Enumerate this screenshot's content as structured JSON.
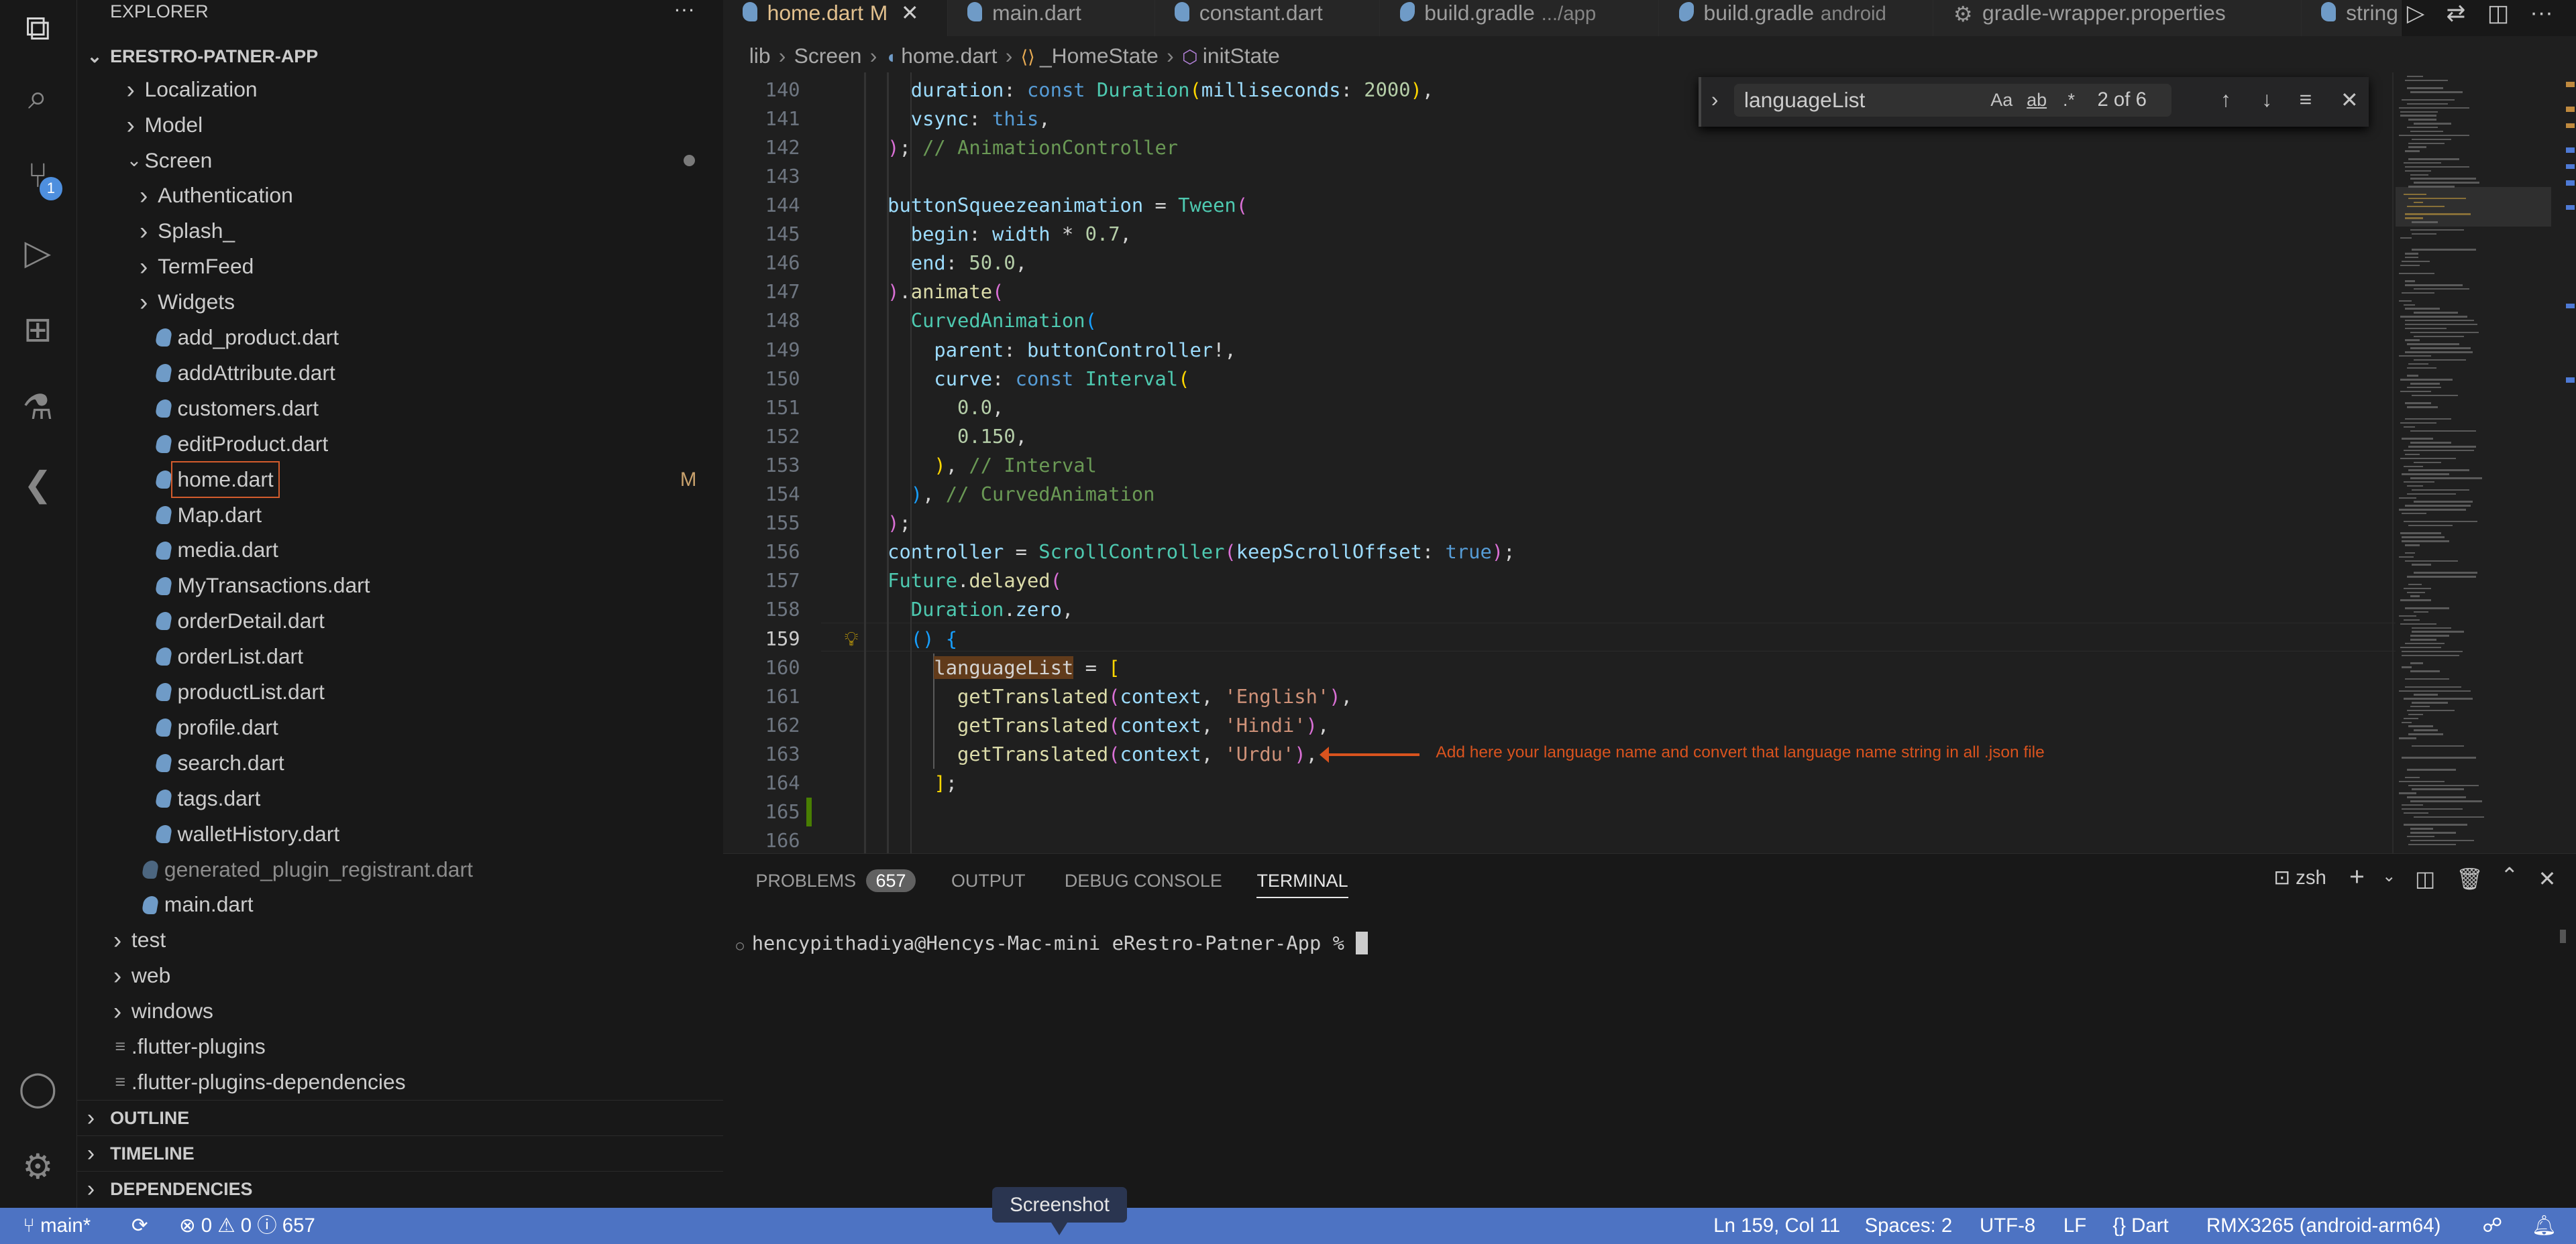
{
  "activity_bar": {
    "items": [
      {
        "name": "explorer-icon",
        "glyph": "⧉"
      },
      {
        "name": "search-icon",
        "glyph": "⌕"
      },
      {
        "name": "source-control-icon",
        "glyph": "⑂",
        "badge": "1"
      },
      {
        "name": "run-debug-icon",
        "glyph": "▷"
      },
      {
        "name": "extensions-icon",
        "glyph": "⊞"
      },
      {
        "name": "testing-icon",
        "glyph": "⚗"
      },
      {
        "name": "flutter-icon",
        "glyph": "❮"
      }
    ],
    "bottom": [
      {
        "name": "account-icon",
        "glyph": "◯"
      },
      {
        "name": "settings-gear-icon",
        "glyph": "⚙"
      }
    ]
  },
  "sidebar": {
    "title": "EXPLORER",
    "more": "···",
    "project": "ERESTRO-PATNER-APP",
    "tree": [
      {
        "label": "Localization",
        "type": "folder",
        "depth": 1
      },
      {
        "label": "Model",
        "type": "folder",
        "depth": 1
      },
      {
        "label": "Screen",
        "type": "folder-open",
        "depth": 1,
        "dot": true
      },
      {
        "label": "Authentication",
        "type": "folder",
        "depth": 2
      },
      {
        "label": "Splash_",
        "type": "folder",
        "depth": 2
      },
      {
        "label": "TermFeed",
        "type": "folder",
        "depth": 2
      },
      {
        "label": "Widgets",
        "type": "folder",
        "depth": 2
      },
      {
        "label": "add_product.dart",
        "type": "dart",
        "depth": 2
      },
      {
        "label": "addAttribute.dart",
        "type": "dart",
        "depth": 2
      },
      {
        "label": "customers.dart",
        "type": "dart",
        "depth": 2
      },
      {
        "label": "editProduct.dart",
        "type": "dart",
        "depth": 2
      },
      {
        "label": "home.dart",
        "type": "dart",
        "depth": 2,
        "selected": true,
        "status": "M"
      },
      {
        "label": "Map.dart",
        "type": "dart",
        "depth": 2
      },
      {
        "label": "media.dart",
        "type": "dart",
        "depth": 2
      },
      {
        "label": "MyTransactions.dart",
        "type": "dart",
        "depth": 2
      },
      {
        "label": "orderDetail.dart",
        "type": "dart",
        "depth": 2
      },
      {
        "label": "orderList.dart",
        "type": "dart",
        "depth": 2
      },
      {
        "label": "productList.dart",
        "type": "dart",
        "depth": 2
      },
      {
        "label": "profile.dart",
        "type": "dart",
        "depth": 2
      },
      {
        "label": "search.dart",
        "type": "dart",
        "depth": 2
      },
      {
        "label": "tags.dart",
        "type": "dart",
        "depth": 2
      },
      {
        "label": "walletHistory.dart",
        "type": "dart",
        "depth": 2
      },
      {
        "label": "generated_plugin_registrant.dart",
        "type": "dart",
        "depth": 1,
        "dim": true
      },
      {
        "label": "main.dart",
        "type": "dart",
        "depth": 1
      },
      {
        "label": "test",
        "type": "folder",
        "depth": 0
      },
      {
        "label": "web",
        "type": "folder",
        "depth": 0
      },
      {
        "label": "windows",
        "type": "folder",
        "depth": 0
      },
      {
        "label": ".flutter-plugins",
        "type": "list",
        "depth": 0
      },
      {
        "label": ".flutter-plugins-dependencies",
        "type": "list",
        "depth": 0
      }
    ],
    "sections": [
      "OUTLINE",
      "TIMELINE",
      "DEPENDENCIES"
    ]
  },
  "tabs": [
    {
      "label": "home.dart",
      "status": "M",
      "active": true,
      "icon": "dart"
    },
    {
      "label": "main.dart",
      "icon": "dart"
    },
    {
      "label": "constant.dart",
      "icon": "dart"
    },
    {
      "label": "build.gradle",
      "desc": ".../app",
      "icon": "gradle"
    },
    {
      "label": "build.gradle",
      "desc": "android",
      "icon": "gradle"
    },
    {
      "label": "gradle-wrapper.properties",
      "icon": "gear"
    },
    {
      "label": "string",
      "icon": "dart"
    }
  ],
  "breadcrumb": [
    "lib",
    "Screen",
    "home.dart",
    "_HomeState",
    "initState"
  ],
  "find": {
    "value": "languageList",
    "options": [
      "Aa",
      "ab",
      ".*"
    ],
    "count": "2 of 6"
  },
  "editor": {
    "current_line": 159,
    "lines": [
      {
        "n": 140,
        "i": 6,
        "t": [
          [
            "var",
            "duration"
          ],
          [
            "p",
            ": "
          ],
          [
            "kw",
            "const "
          ],
          [
            "cls",
            "Duration"
          ],
          [
            "bg",
            "("
          ],
          [
            "var",
            "milliseconds"
          ],
          [
            "p",
            ": "
          ],
          [
            "num",
            "2000"
          ],
          [
            "bg",
            ")"
          ],
          [
            "p",
            ","
          ]
        ]
      },
      {
        "n": 141,
        "i": 6,
        "t": [
          [
            "var",
            "vsync"
          ],
          [
            "p",
            ": "
          ],
          [
            "kw",
            "this"
          ],
          [
            "p",
            ","
          ]
        ]
      },
      {
        "n": 142,
        "i": 4,
        "t": [
          [
            "bp",
            ")"
          ],
          [
            "p",
            "; "
          ],
          [
            "cm",
            "// AnimationController"
          ]
        ]
      },
      {
        "n": 143,
        "i": 0,
        "t": []
      },
      {
        "n": 144,
        "i": 4,
        "t": [
          [
            "var",
            "buttonSqueezeanimation"
          ],
          [
            "p",
            " = "
          ],
          [
            "cls",
            "Tween"
          ],
          [
            "bp",
            "("
          ]
        ]
      },
      {
        "n": 145,
        "i": 6,
        "t": [
          [
            "var",
            "begin"
          ],
          [
            "p",
            ": "
          ],
          [
            "var",
            "width"
          ],
          [
            "p",
            " * "
          ],
          [
            "num",
            "0.7"
          ],
          [
            "p",
            ","
          ]
        ]
      },
      {
        "n": 146,
        "i": 6,
        "t": [
          [
            "var",
            "end"
          ],
          [
            "p",
            ": "
          ],
          [
            "num",
            "50.0"
          ],
          [
            "p",
            ","
          ]
        ]
      },
      {
        "n": 147,
        "i": 4,
        "t": [
          [
            "bp",
            ")"
          ],
          [
            "p",
            "."
          ],
          [
            "fn",
            "animate"
          ],
          [
            "bp",
            "("
          ]
        ]
      },
      {
        "n": 148,
        "i": 6,
        "t": [
          [
            "cls",
            "CurvedAnimation"
          ],
          [
            "bb",
            "("
          ]
        ]
      },
      {
        "n": 149,
        "i": 8,
        "t": [
          [
            "var",
            "parent"
          ],
          [
            "p",
            ": "
          ],
          [
            "var",
            "buttonController"
          ],
          [
            "p",
            "!,"
          ]
        ]
      },
      {
        "n": 150,
        "i": 8,
        "t": [
          [
            "var",
            "curve"
          ],
          [
            "p",
            ": "
          ],
          [
            "kw",
            "const "
          ],
          [
            "cls",
            "Interval"
          ],
          [
            "bg",
            "("
          ]
        ]
      },
      {
        "n": 151,
        "i": 10,
        "t": [
          [
            "num",
            "0.0"
          ],
          [
            "p",
            ","
          ]
        ]
      },
      {
        "n": 152,
        "i": 10,
        "t": [
          [
            "num",
            "0.150"
          ],
          [
            "p",
            ","
          ]
        ]
      },
      {
        "n": 153,
        "i": 8,
        "t": [
          [
            "bg",
            ")"
          ],
          [
            "p",
            ", "
          ],
          [
            "cm",
            "// Interval"
          ]
        ]
      },
      {
        "n": 154,
        "i": 6,
        "t": [
          [
            "bb",
            ")"
          ],
          [
            "p",
            ", "
          ],
          [
            "cm",
            "// CurvedAnimation"
          ]
        ]
      },
      {
        "n": 155,
        "i": 4,
        "t": [
          [
            "bp",
            ")"
          ],
          [
            "p",
            ";"
          ]
        ]
      },
      {
        "n": 156,
        "i": 4,
        "t": [
          [
            "var",
            "controller"
          ],
          [
            "p",
            " = "
          ],
          [
            "cls",
            "ScrollController"
          ],
          [
            "bp",
            "("
          ],
          [
            "var",
            "keepScrollOffset"
          ],
          [
            "p",
            ": "
          ],
          [
            "kw",
            "true"
          ],
          [
            "bp",
            ")"
          ],
          [
            "p",
            ";"
          ]
        ]
      },
      {
        "n": 157,
        "i": 4,
        "t": [
          [
            "cls",
            "Future"
          ],
          [
            "p",
            "."
          ],
          [
            "fn",
            "delayed"
          ],
          [
            "bp",
            "("
          ]
        ]
      },
      {
        "n": 158,
        "i": 6,
        "t": [
          [
            "cls",
            "Duration"
          ],
          [
            "p",
            "."
          ],
          [
            "var",
            "zero"
          ],
          [
            "p",
            ","
          ]
        ]
      },
      {
        "n": 159,
        "i": 6,
        "t": [
          [
            "bb",
            "()"
          ],
          [
            "p",
            " "
          ],
          [
            "bb",
            "{"
          ]
        ]
      },
      {
        "n": 160,
        "i": 8,
        "t": [
          [
            "hl",
            "languageList"
          ],
          [
            "p",
            " = "
          ],
          [
            "bg",
            "["
          ]
        ]
      },
      {
        "n": 161,
        "i": 10,
        "t": [
          [
            "fn",
            "getTranslated"
          ],
          [
            "bp",
            "("
          ],
          [
            "var",
            "context"
          ],
          [
            "p",
            ", "
          ],
          [
            "str",
            "'English'"
          ],
          [
            "bp",
            ")"
          ],
          [
            "p",
            ","
          ]
        ]
      },
      {
        "n": 162,
        "i": 10,
        "t": [
          [
            "fn",
            "getTranslated"
          ],
          [
            "bp",
            "("
          ],
          [
            "var",
            "context"
          ],
          [
            "p",
            ", "
          ],
          [
            "str",
            "'Hindi'"
          ],
          [
            "bp",
            ")"
          ],
          [
            "p",
            ","
          ]
        ]
      },
      {
        "n": 163,
        "i": 10,
        "t": [
          [
            "fn",
            "getTranslated"
          ],
          [
            "bp",
            "("
          ],
          [
            "var",
            "context"
          ],
          [
            "p",
            ", "
          ],
          [
            "str",
            "'Urdu'"
          ],
          [
            "bp",
            ")"
          ],
          [
            "p",
            ","
          ]
        ]
      },
      {
        "n": 164,
        "i": 8,
        "t": [
          [
            "bg",
            "]"
          ],
          [
            "p",
            ";"
          ]
        ]
      },
      {
        "n": 165,
        "i": 0,
        "t": []
      },
      {
        "n": 166,
        "i": 0,
        "t": []
      }
    ]
  },
  "annotation": {
    "text": "Add here your language name and convert that language name string in all .json file",
    "color": "#d9531e"
  },
  "panel": {
    "tabs": [
      {
        "label": "PROBLEMS",
        "badge": "657"
      },
      {
        "label": "OUTPUT"
      },
      {
        "label": "DEBUG CONSOLE"
      },
      {
        "label": "TERMINAL",
        "active": true
      }
    ],
    "shell": "zsh",
    "terminal_line": "hencypithadiya@Hencys-Mac-mini eRestro-Patner-App % "
  },
  "status": {
    "branch": "main*",
    "errors": "0",
    "warnings": "0",
    "info": "657",
    "position": "Ln 159, Col 11",
    "spaces": "Spaces: 2",
    "encoding": "UTF-8",
    "eol": "LF",
    "language": "Dart",
    "device": "RMX3265 (android-arm64)",
    "color": "#4d73c3"
  },
  "tooltip": "Screenshot"
}
